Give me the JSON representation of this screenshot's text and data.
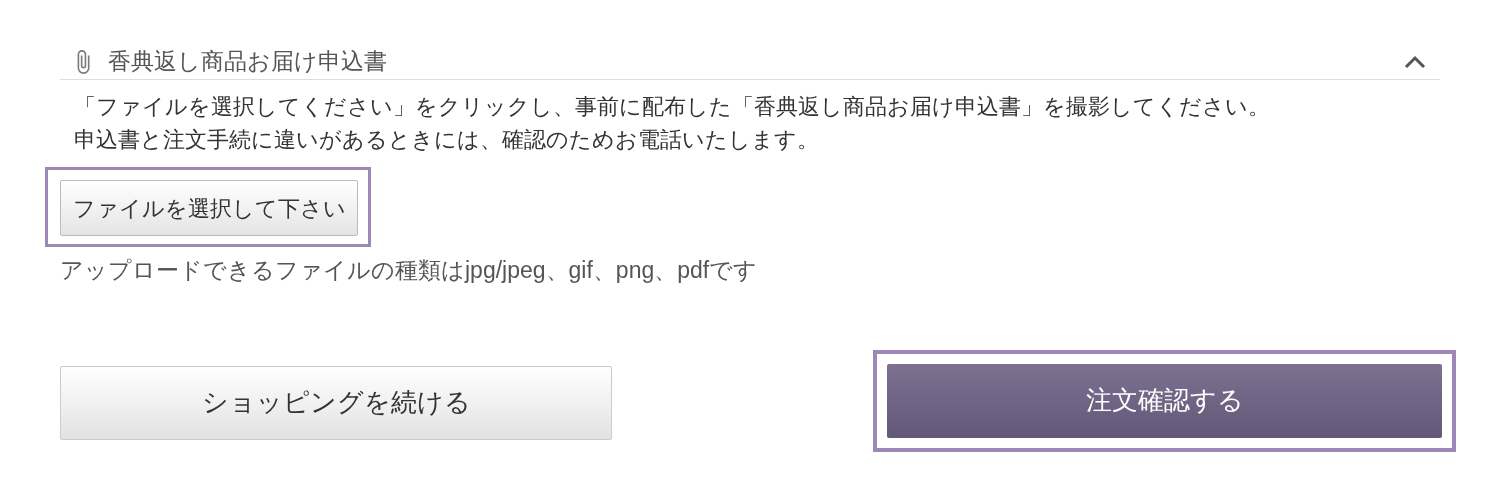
{
  "section": {
    "title": "香典返し商品お届け申込書",
    "expanded": true,
    "description": [
      "「ファイルを選択してください」をクリックし、事前に配布した「香典返し商品お届け申込書」を撮影してください。",
      "申込書と注文手続に違いがあるときには、確認のためお電話いたします。"
    ],
    "file_button": {
      "label": "ファイルを選択して下さい",
      "outlined": true
    },
    "note": "アップロードできるファイルの種類はjpg/jpeg、gif、png、pdfです"
  },
  "actions": [
    {
      "label": "ショッピングを続ける",
      "kind": "secondary",
      "outlined": false
    },
    {
      "label": "注文確認する",
      "kind": "primary",
      "outlined": true
    }
  ]
}
